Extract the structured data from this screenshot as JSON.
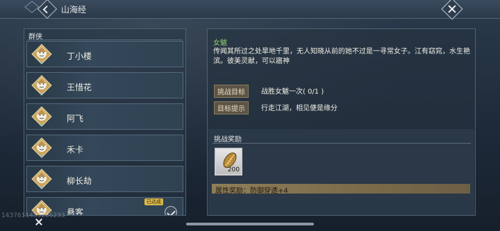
{
  "window": {
    "title": "山海经"
  },
  "left_panel": {
    "header": "群侠",
    "characters": [
      {
        "name": "丁小楼",
        "badge": "",
        "completed": false
      },
      {
        "name": "王惜花",
        "badge": "",
        "completed": false
      },
      {
        "name": "阿飞",
        "badge": "",
        "completed": false
      },
      {
        "name": "禾卡",
        "badge": "",
        "completed": false
      },
      {
        "name": "柳长劫",
        "badge": "",
        "completed": false
      },
      {
        "name": "悬客",
        "badge": "已达成",
        "completed": true
      }
    ]
  },
  "detail": {
    "name": "女魃",
    "description": "传闻其所过之处旱地千里，无人知晓从前的她不过是一寻常女子。江有窈窕，水生艳滨。彼美灵献，可以寤神",
    "challenge_target_label": "挑战目标",
    "challenge_target_value": "战胜女魃一次( 0/1 )",
    "hint_label": "目标提示",
    "hint_value": "行走江湖，相见便是缘分"
  },
  "reward": {
    "title": "挑战奖励",
    "item_icon": "seed-pod-icon",
    "item_qty": "200",
    "attribute": "属性奖励：防御穿透+4"
  },
  "footer": {
    "watermark": "1437611453286233"
  }
}
